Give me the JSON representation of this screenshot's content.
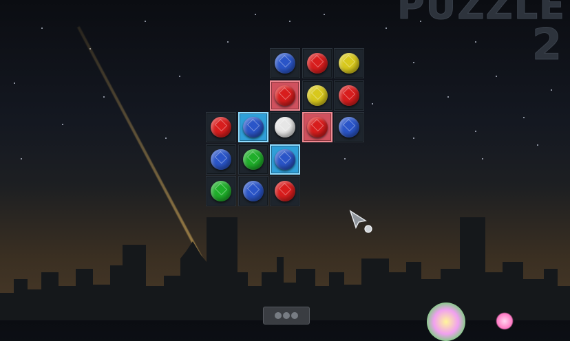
{
  "title": {
    "word": "PUZZLE",
    "number": "2"
  },
  "colors": {
    "red": "#d81d1d",
    "blue": "#2a55c8",
    "yellow": "#d8c81c",
    "green": "#1fae2a",
    "white": "#e6e6e6",
    "select_red": "#d0515e",
    "select_blue": "#2f9fd8"
  },
  "board": {
    "rows": [
      [
        "empty",
        "empty",
        "blue",
        "red",
        "yellow"
      ],
      [
        "empty",
        "empty",
        "red",
        "yellow",
        "red"
      ],
      [
        "red",
        "blue",
        "white",
        "red",
        "blue"
      ],
      [
        "blue",
        "green",
        "blue",
        "empty",
        "empty"
      ],
      [
        "green",
        "blue",
        "red",
        "empty",
        "empty"
      ]
    ],
    "highlights": [
      [
        "none",
        "none",
        "none",
        "none",
        "none"
      ],
      [
        "none",
        "none",
        "red",
        "none",
        "none"
      ],
      [
        "none",
        "blue",
        "none",
        "red",
        "none"
      ],
      [
        "none",
        "none",
        "blue",
        "none",
        "none"
      ],
      [
        "none",
        "none",
        "none",
        "none",
        "none"
      ]
    ]
  }
}
